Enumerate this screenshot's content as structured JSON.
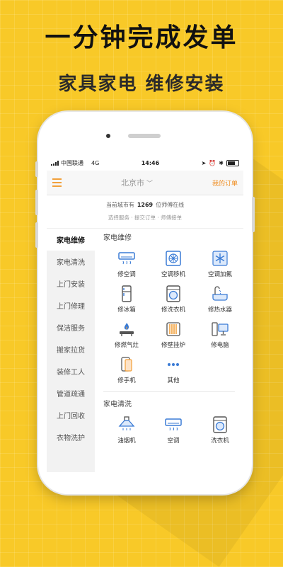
{
  "banner": {
    "headline": "一分钟完成发单",
    "subline": "家具家电 维修安装"
  },
  "status_bar": {
    "carrier": "中国联通",
    "network": "4G",
    "time": "14:46"
  },
  "nav": {
    "city": "北京市",
    "my_orders": "我的订单"
  },
  "info": {
    "prefix": "当前城市有",
    "count": "1269",
    "suffix": "位师傅在线",
    "steps": "选择服务 · 提交订单 · 师傅接单"
  },
  "sidebar": {
    "items": [
      {
        "label": "家电维修",
        "active": true
      },
      {
        "label": "家电清洗"
      },
      {
        "label": "上门安装"
      },
      {
        "label": "上门修理"
      },
      {
        "label": "保洁服务"
      },
      {
        "label": "搬家拉货"
      },
      {
        "label": "装修工人"
      },
      {
        "label": "管道疏通"
      },
      {
        "label": "上门回收"
      },
      {
        "label": "衣物洗护"
      }
    ]
  },
  "sections": {
    "repair": {
      "title": "家电维修",
      "items": [
        {
          "label": "修空调",
          "icon": "air-conditioner-icon"
        },
        {
          "label": "空调移机",
          "icon": "ac-relocation-icon"
        },
        {
          "label": "空调加氟",
          "icon": "snowflake-icon"
        },
        {
          "label": "修冰箱",
          "icon": "fridge-icon"
        },
        {
          "label": "修洗衣机",
          "icon": "washing-machine-icon"
        },
        {
          "label": "修热水器",
          "icon": "water-heater-icon"
        },
        {
          "label": "修燃气灶",
          "icon": "gas-stove-icon"
        },
        {
          "label": "修壁挂炉",
          "icon": "wall-boiler-icon"
        },
        {
          "label": "修电脑",
          "icon": "computer-icon"
        },
        {
          "label": "修手机",
          "icon": "phone-icon"
        },
        {
          "label": "其他",
          "icon": "more-dots-icon"
        }
      ]
    },
    "cleaning": {
      "title": "家电清洗",
      "items": [
        {
          "label": "油烟机",
          "icon": "range-hood-icon"
        },
        {
          "label": "空调",
          "icon": "air-conditioner-icon"
        },
        {
          "label": "洗衣机",
          "icon": "washing-machine-icon"
        }
      ]
    }
  },
  "colors": {
    "background": "#f8c928",
    "accent": "#f08c1e",
    "icon_blue": "#3a7bd5",
    "icon_orange": "#f2a03a"
  }
}
